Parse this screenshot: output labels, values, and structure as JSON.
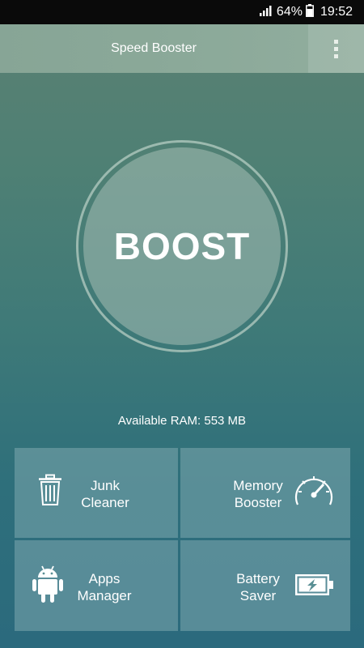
{
  "status_bar": {
    "battery_percent": "64%",
    "time": "19:52",
    "icons": [
      "signal-icon",
      "battery-icon"
    ]
  },
  "app_bar": {
    "title": "Speed Booster",
    "menu_icon": "overflow-menu-icon"
  },
  "boost_button": {
    "label": "BOOST"
  },
  "ram": {
    "text": "Available RAM: 553 MB"
  },
  "tiles": [
    {
      "line1": "Junk",
      "line2": "Cleaner",
      "icon": "trash-icon"
    },
    {
      "line1": "Memory",
      "line2": "Booster",
      "icon": "speedometer-icon"
    },
    {
      "line1": "Apps",
      "line2": "Manager",
      "icon": "android-icon"
    },
    {
      "line1": "Battery",
      "line2": "Saver",
      "icon": "battery-charging-icon"
    }
  ],
  "colors": {
    "accent_tile": "#8cb5bc",
    "text": "#ffffff",
    "status_bar": "#0a0a0a"
  }
}
